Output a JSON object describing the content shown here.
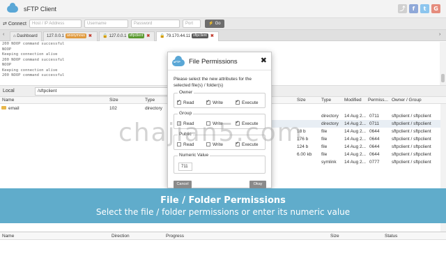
{
  "app": {
    "title": "sFTP Client"
  },
  "social": [
    {
      "icon": "share-icon",
      "glyph": "⤴",
      "color": "#d0d0d0"
    },
    {
      "icon": "facebook-icon",
      "glyph": "f",
      "color": "#8fa8d8"
    },
    {
      "icon": "twitter-icon",
      "glyph": "t",
      "color": "#8cc5ee"
    },
    {
      "icon": "googleplus-icon",
      "glyph": "G",
      "color": "#e58c7d"
    }
  ],
  "connect": {
    "label": "Connect",
    "host_placeholder": "Host / IP Address",
    "user_placeholder": "Username",
    "pass_placeholder": "Password",
    "port_placeholder": "Port",
    "go_label": "Go"
  },
  "tabs": [
    {
      "label": "Dashboard",
      "badge": ""
    },
    {
      "label": "127.0.0.1",
      "badge": "anonymous",
      "badge_color": "#e09a3e"
    },
    {
      "label": "127.0.0.1",
      "badge": "sftpclient",
      "badge_color": "#5a9a2f"
    },
    {
      "label": "79.170.44.11",
      "badge": "sftpclient",
      "badge_color": "#5a5a5a"
    }
  ],
  "log": [
    "200 NOOP command successful",
    "NOOP",
    "Keeping connection alive",
    "200 NOOP command successful",
    "NOOP",
    "Keeping connection alive",
    "200 NOOP command successful"
  ],
  "local": {
    "label": "Local",
    "path": "/sftpclient",
    "columns": [
      "Name",
      "Size",
      "Type"
    ],
    "rows": [
      {
        "name": "email",
        "size": "102",
        "type": "directory"
      }
    ]
  },
  "remote": {
    "columns": [
      "Size",
      "Type",
      "Modified",
      "Permiss...",
      "Owner / Group"
    ],
    "rows": [
      {
        "size": "",
        "type": "directory",
        "modified": "14 Aug 2...",
        "perm": "0711",
        "owner": "sftpclient / sftpclient"
      },
      {
        "size": "",
        "type": "directory",
        "modified": "14 Aug 2...",
        "perm": "0711",
        "owner": "sftpclient / sftpclient"
      },
      {
        "size": "18 b",
        "type": "file",
        "modified": "14 Aug 2...",
        "perm": "0644",
        "owner": "sftpclient / sftpclient"
      },
      {
        "size": "176 b",
        "type": "file",
        "modified": "14 Aug 2...",
        "perm": "0644",
        "owner": "sftpclient / sftpclient"
      },
      {
        "size": "124 b",
        "type": "file",
        "modified": "14 Aug 2...",
        "perm": "0644",
        "owner": "sftpclient / sftpclient"
      },
      {
        "size": "6.00 kb",
        "type": "file",
        "modified": "14 Aug 2...",
        "perm": "0644",
        "owner": "sftpclient / sftpclient"
      },
      {
        "size": "",
        "type": "symlink",
        "modified": "14 Aug 2...",
        "perm": "0777",
        "owner": "sftpclient / sftpclient"
      }
    ]
  },
  "modal": {
    "title": "File Permissions",
    "description": "Please select the new attributes for the selected file(s) / folder(s)",
    "owner": {
      "label": "Owner",
      "read": "Read",
      "write": "Write",
      "execute": "Execute"
    },
    "group": {
      "label": "Group",
      "read": "Read",
      "write": "Write",
      "execute": "Execute"
    },
    "public": {
      "label": "Public",
      "read": "Read",
      "write": "Write",
      "execute": "Execute"
    },
    "numeric": {
      "label": "Numeric Value",
      "value": "711"
    },
    "cancel": "Cancel",
    "okay": "Okay"
  },
  "banner": {
    "title": "File / Folder Permissions",
    "subtitle": "Select the file / folder permissions or enter its numeric value"
  },
  "transfers": {
    "columns": [
      "Name",
      "Direction",
      "Progress",
      "Size",
      "Status"
    ]
  },
  "watermark": "chajian5.com"
}
